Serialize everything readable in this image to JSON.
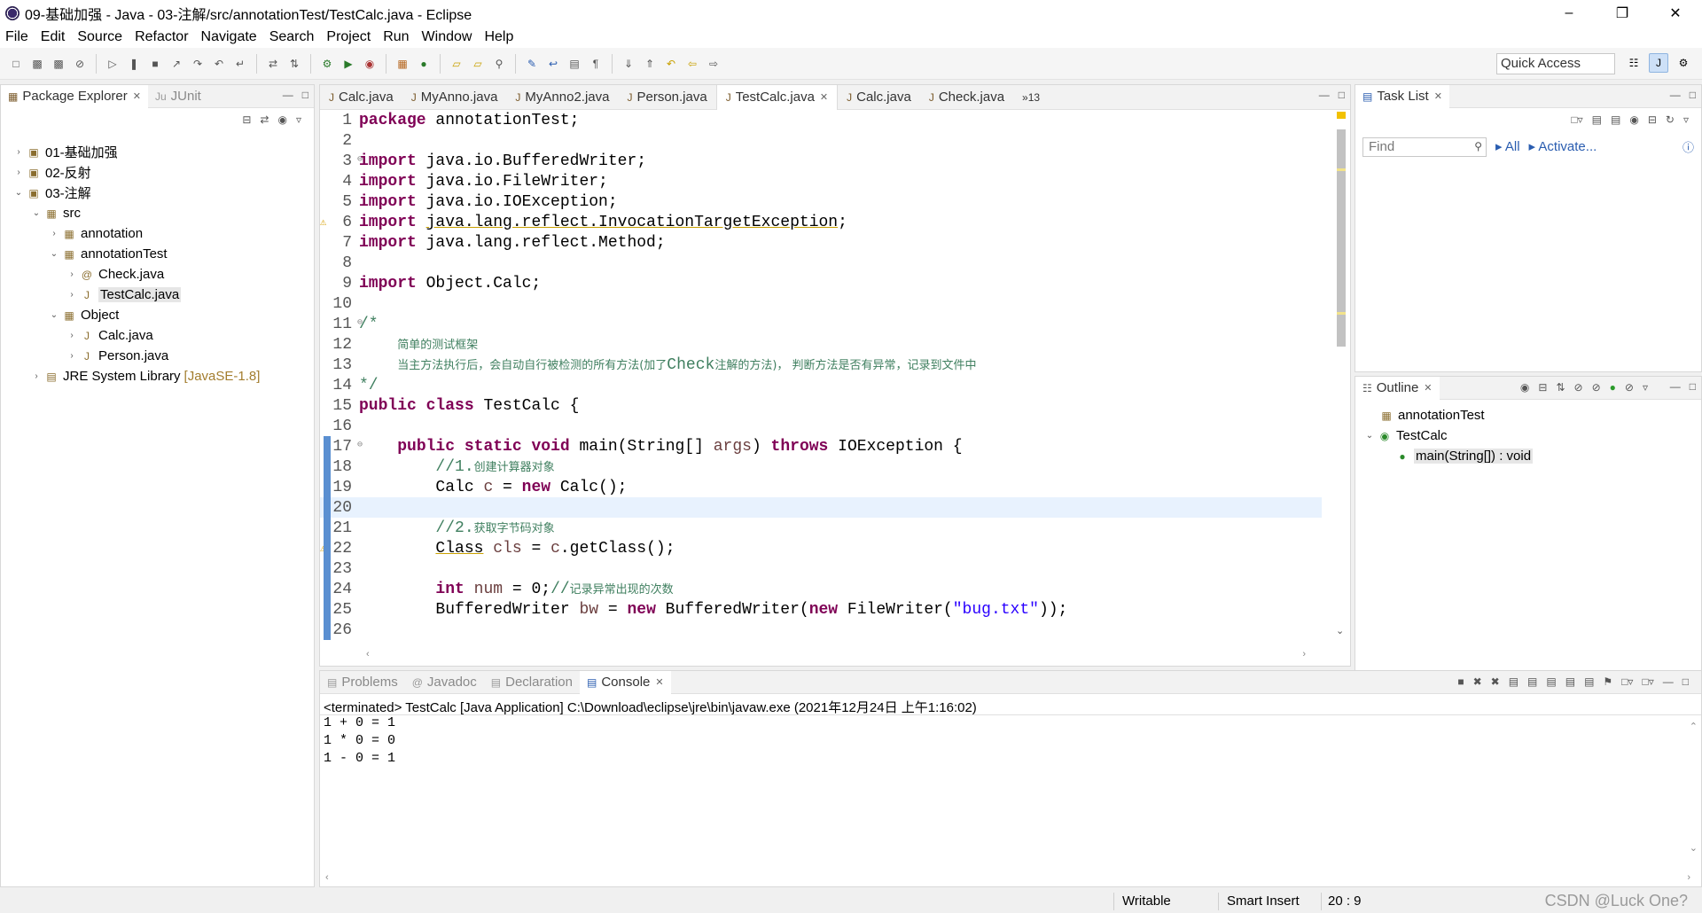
{
  "window": {
    "title": "09-基础加强 - Java - 03-注解/src/annotationTest/TestCalc.java - Eclipse"
  },
  "menu": [
    "File",
    "Edit",
    "Source",
    "Refactor",
    "Navigate",
    "Search",
    "Project",
    "Run",
    "Window",
    "Help"
  ],
  "toolbar": {
    "quick_access": "Quick Access"
  },
  "package_explorer": {
    "tab": "Package Explorer",
    "tab2": "JUnit",
    "tree": [
      {
        "label": "01-基础加强",
        "depth": 0,
        "twisty": ">",
        "icon": "project-icon"
      },
      {
        "label": "02-反射",
        "depth": 0,
        "twisty": ">",
        "icon": "project-icon"
      },
      {
        "label": "03-注解",
        "depth": 0,
        "twisty": "v",
        "icon": "project-icon"
      },
      {
        "label": "src",
        "depth": 1,
        "twisty": "v",
        "icon": "source-folder-icon"
      },
      {
        "label": "annotation",
        "depth": 2,
        "twisty": ">",
        "icon": "package-icon"
      },
      {
        "label": "annotationTest",
        "depth": 2,
        "twisty": "v",
        "icon": "package-icon"
      },
      {
        "label": "Check.java",
        "depth": 3,
        "twisty": ">",
        "icon": "annotation-file-icon"
      },
      {
        "label": "TestCalc.java",
        "depth": 3,
        "twisty": ">",
        "icon": "java-file-icon",
        "selected": true
      },
      {
        "label": "Object",
        "depth": 2,
        "twisty": "v",
        "icon": "package-icon"
      },
      {
        "label": "Calc.java",
        "depth": 3,
        "twisty": ">",
        "icon": "java-file-icon"
      },
      {
        "label": "Person.java",
        "depth": 3,
        "twisty": ">",
        "icon": "java-file-icon"
      },
      {
        "label": "JRE System Library",
        "note": "[JavaSE-1.8]",
        "depth": 1,
        "twisty": ">",
        "icon": "library-icon"
      }
    ]
  },
  "editor": {
    "tabs": [
      {
        "label": "Calc.java",
        "active": false
      },
      {
        "label": "MyAnno.java",
        "active": false
      },
      {
        "label": "MyAnno2.java",
        "active": false
      },
      {
        "label": "Person.java",
        "active": false
      },
      {
        "label": "TestCalc.java",
        "active": true
      },
      {
        "label": "Calc.java",
        "active": false
      },
      {
        "label": "Check.java",
        "active": false
      }
    ],
    "overflow": "»13",
    "lines": [
      {
        "n": "1",
        "tokens": [
          [
            "kw",
            "package"
          ],
          [
            "t",
            " annotationTest;"
          ]
        ]
      },
      {
        "n": "2",
        "tokens": []
      },
      {
        "n": "3",
        "fold": true,
        "tokens": [
          [
            "kw",
            "import"
          ],
          [
            "t",
            " java.io.BufferedWriter;"
          ]
        ]
      },
      {
        "n": "4",
        "tokens": [
          [
            "kw",
            "import"
          ],
          [
            "t",
            " java.io.FileWriter;"
          ]
        ]
      },
      {
        "n": "5",
        "tokens": [
          [
            "kw",
            "import"
          ],
          [
            "t",
            " java.io.IOException;"
          ]
        ]
      },
      {
        "n": "6",
        "warn": true,
        "tokens": [
          [
            "kw",
            "import"
          ],
          [
            "t",
            " "
          ],
          [
            "ul",
            "java.lang.reflect.InvocationTargetException"
          ],
          [
            "t",
            ";"
          ]
        ]
      },
      {
        "n": "7",
        "tokens": [
          [
            "kw",
            "import"
          ],
          [
            "t",
            " java.lang.reflect.Method;"
          ]
        ]
      },
      {
        "n": "8",
        "tokens": []
      },
      {
        "n": "9",
        "tokens": [
          [
            "kw",
            "import"
          ],
          [
            "t",
            " Object.Calc;"
          ]
        ]
      },
      {
        "n": "10",
        "tokens": []
      },
      {
        "n": "11",
        "fold": true,
        "tokens": [
          [
            "cm",
            "/*"
          ]
        ]
      },
      {
        "n": "12",
        "tokens": [
          [
            "t",
            "    "
          ],
          [
            "cz",
            "简单的测试框架"
          ]
        ]
      },
      {
        "n": "13",
        "tokens": [
          [
            "t",
            "    "
          ],
          [
            "cz",
            "当主方法执行后，会自动自行被检测的所有方法(加了"
          ],
          [
            "cm",
            "Check"
          ],
          [
            "cz",
            "注解的方法)， 判断方法是否有异常，记录到文件中"
          ]
        ]
      },
      {
        "n": "14",
        "tokens": [
          [
            "cm",
            "*/"
          ]
        ]
      },
      {
        "n": "15",
        "tokens": [
          [
            "kw",
            "public"
          ],
          [
            "t",
            " "
          ],
          [
            "kw",
            "class"
          ],
          [
            "t",
            " TestCalc {"
          ]
        ]
      },
      {
        "n": "16",
        "tokens": []
      },
      {
        "n": "17",
        "fold": true,
        "tokens": [
          [
            "t",
            "    "
          ],
          [
            "kw",
            "public"
          ],
          [
            "t",
            " "
          ],
          [
            "kw",
            "static"
          ],
          [
            "t",
            " "
          ],
          [
            "kw",
            "void"
          ],
          [
            "t",
            " main(String[] "
          ],
          [
            "var",
            "args"
          ],
          [
            "t",
            ") "
          ],
          [
            "kw",
            "throws"
          ],
          [
            "t",
            " IOException {"
          ]
        ]
      },
      {
        "n": "18",
        "tokens": [
          [
            "t",
            "        "
          ],
          [
            "cm",
            "//1."
          ],
          [
            "cz",
            "创建计算器对象"
          ]
        ]
      },
      {
        "n": "19",
        "tokens": [
          [
            "t",
            "        Calc "
          ],
          [
            "var",
            "c"
          ],
          [
            "t",
            " = "
          ],
          [
            "kw",
            "new"
          ],
          [
            "t",
            " Calc();"
          ]
        ]
      },
      {
        "n": "20",
        "current": true,
        "tokens": []
      },
      {
        "n": "21",
        "tokens": [
          [
            "t",
            "        "
          ],
          [
            "cm",
            "//2."
          ],
          [
            "cz",
            "获取字节码对象"
          ]
        ]
      },
      {
        "n": "22",
        "warn": true,
        "tokens": [
          [
            "t",
            "        "
          ],
          [
            "ul",
            "Class"
          ],
          [
            "t",
            " "
          ],
          [
            "var",
            "cls"
          ],
          [
            "t",
            " = "
          ],
          [
            "var",
            "c"
          ],
          [
            "t",
            ".getClass();"
          ]
        ]
      },
      {
        "n": "23",
        "tokens": []
      },
      {
        "n": "24",
        "tokens": [
          [
            "t",
            "        "
          ],
          [
            "kw",
            "int"
          ],
          [
            "t",
            " "
          ],
          [
            "var",
            "num"
          ],
          [
            "t",
            " = 0;"
          ],
          [
            "cm",
            "//"
          ],
          [
            "cz",
            "记录异常出现的次数"
          ]
        ]
      },
      {
        "n": "25",
        "tokens": [
          [
            "t",
            "        BufferedWriter "
          ],
          [
            "var",
            "bw"
          ],
          [
            "t",
            " = "
          ],
          [
            "kw",
            "new"
          ],
          [
            "t",
            " BufferedWriter("
          ],
          [
            "kw",
            "new"
          ],
          [
            "t",
            " FileWriter("
          ],
          [
            "str",
            "\"bug.txt\""
          ],
          [
            "t",
            "));"
          ]
        ]
      },
      {
        "n": "26",
        "tokens": []
      }
    ]
  },
  "task_list": {
    "tab": "Task List",
    "find_placeholder": "Find",
    "link_all": "All",
    "link_activate": "Activate..."
  },
  "outline": {
    "tab": "Outline",
    "items": [
      {
        "label": "annotationTest",
        "depth": 0,
        "icon": "package-icon"
      },
      {
        "label": "TestCalc",
        "depth": 0,
        "twisty": "v",
        "icon": "class-icon"
      },
      {
        "label": "main(String[]) : void",
        "depth": 1,
        "icon": "method-icon",
        "selected": true
      }
    ]
  },
  "console": {
    "tabs": [
      {
        "label": "Problems",
        "active": false
      },
      {
        "label": "Javadoc",
        "active": false
      },
      {
        "label": "Declaration",
        "active": false
      },
      {
        "label": "Console",
        "active": true
      }
    ],
    "terminated": "<terminated> TestCalc [Java Application] C:\\Download\\eclipse\\jre\\bin\\javaw.exe (2021年12月24日 上午1:16:02)",
    "output": [
      "1 + 0 = 1",
      "1 * 0 = 0",
      "1 - 0 = 1"
    ]
  },
  "status": {
    "writable": "Writable",
    "insert_mode": "Smart Insert",
    "position": "20 : 9",
    "watermark": "CSDN @Luck  One?"
  },
  "colors": {
    "keyword": "#7f0055",
    "comment": "#3f7f5f",
    "string": "#2a00ff",
    "variable": "#6a3e3e",
    "current_line": "#e8f2fe"
  }
}
